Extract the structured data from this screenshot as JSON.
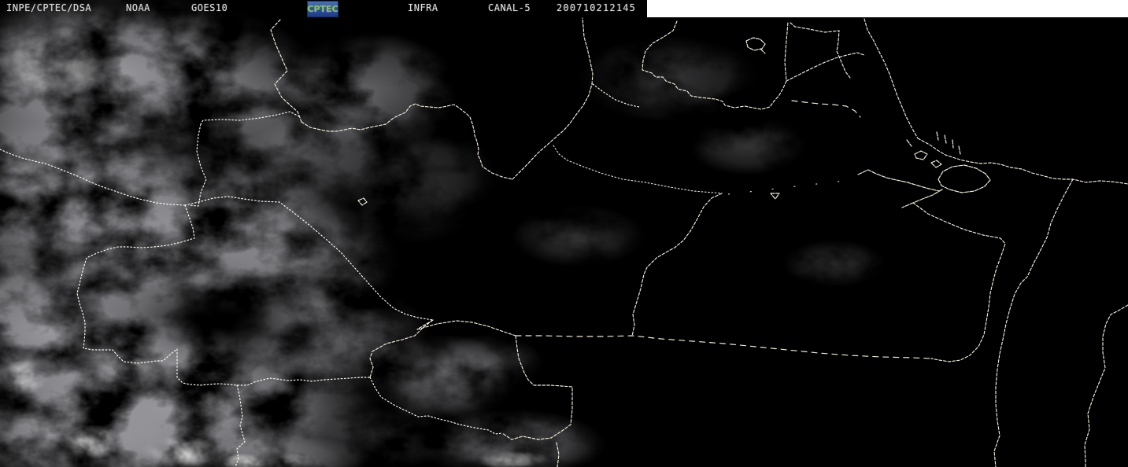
{
  "header": {
    "agency": "INPE/CPTEC/DSA",
    "operator": "NOAA",
    "satellite": "GOES10",
    "logo": "CPTEC",
    "band": "INFRA",
    "channel": "CANAL-5",
    "timestamp": "200710212145"
  },
  "colors": {
    "background": "#000000",
    "header_text": "#d9d9d9",
    "boundary_line": "#f3eeda",
    "white_bar": "#ffffff",
    "logo_background": "#2a55a4",
    "logo_text": "#79cc49"
  }
}
